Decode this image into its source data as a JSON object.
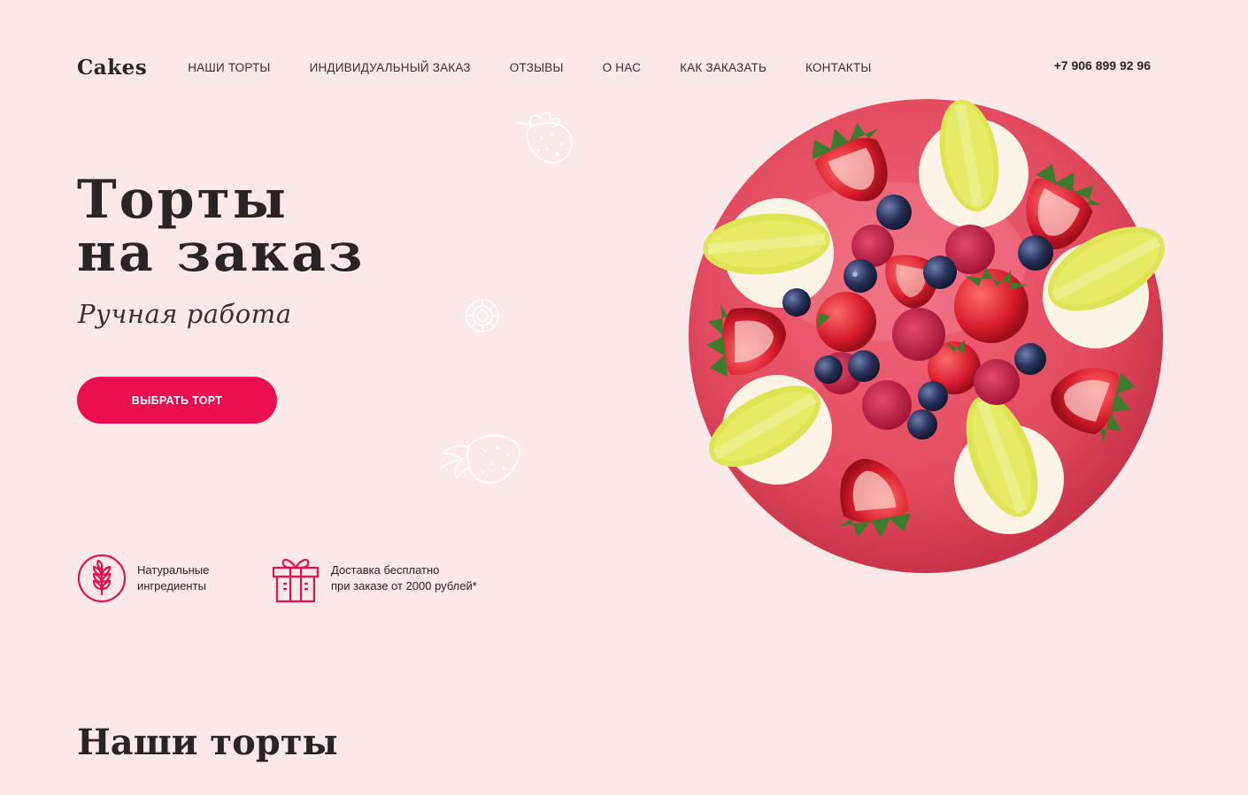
{
  "header": {
    "logo": "Cakes",
    "nav": [
      "НАШИ ТОРТЫ",
      "ИНДИВИДУАЛЬНЫЙ ЗАКАЗ",
      "ОТЗЫВЫ",
      "О НАС",
      "КАК ЗАКАЗАТЬ",
      "КОНТАКТЫ"
    ],
    "phone": "+7 906 899 92 96"
  },
  "hero": {
    "title_line1": "Торты",
    "title_line2": "на заказ",
    "subtitle": "Ручная работа",
    "cta_label": "ВЫБРАТЬ ТОРТ"
  },
  "features": [
    {
      "icon": "wheat-icon",
      "line1": "Натуральные",
      "line2": "ингредиенты"
    },
    {
      "icon": "gift-icon",
      "line1": "Доставка бесплатно",
      "line2": "при заказе от 2000 рублей*"
    }
  ],
  "section": {
    "title": "Наши торты"
  },
  "colors": {
    "background": "#fbe9ea",
    "accent": "#ec0c50",
    "text": "#2b2424",
    "glaze": "#e54a5e",
    "macaron": "#e6ec6a"
  }
}
